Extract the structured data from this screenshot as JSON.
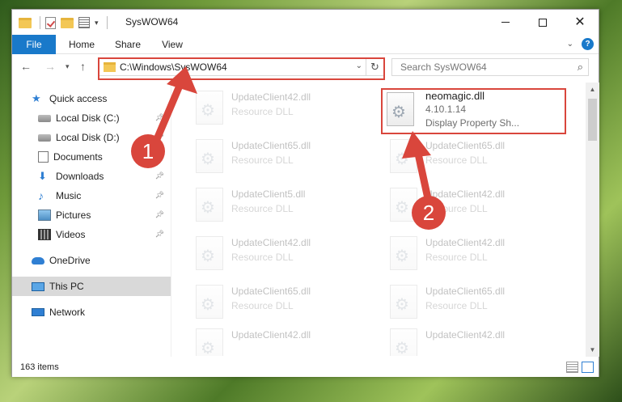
{
  "window": {
    "title": "SysWOW64",
    "controls": {
      "minimize": "—",
      "maximize": "□",
      "close": "✕"
    }
  },
  "ribbon": {
    "tabs": [
      {
        "label": "File"
      },
      {
        "label": "Home"
      },
      {
        "label": "Share"
      },
      {
        "label": "View"
      }
    ],
    "help": "?"
  },
  "navigation": {
    "address": "C:\\Windows\\SysWOW64",
    "search_placeholder": "Search SysWOW64"
  },
  "sidebar": {
    "items": [
      {
        "label": "Quick access",
        "icon": "star-icon"
      },
      {
        "label": "Local Disk (C:)",
        "icon": "disk-icon"
      },
      {
        "label": "Local Disk (D:)",
        "icon": "disk-icon"
      },
      {
        "label": "Documents",
        "icon": "documents-icon"
      },
      {
        "label": "Downloads",
        "icon": "download-icon"
      },
      {
        "label": "Music",
        "icon": "music-icon"
      },
      {
        "label": "Pictures",
        "icon": "pictures-icon"
      },
      {
        "label": "Videos",
        "icon": "videos-icon"
      },
      {
        "label": "OneDrive",
        "icon": "cloud-icon"
      },
      {
        "label": "This PC",
        "icon": "computer-icon"
      },
      {
        "label": "Network",
        "icon": "network-icon"
      }
    ]
  },
  "files": {
    "highlighted": {
      "name": "neomagic.dll",
      "version": "4.10.1.14",
      "description": "Display Property Sh..."
    },
    "items": [
      {
        "name": "UpdateClient42.dll",
        "type": "Resource DLL"
      },
      {
        "name": "UpdateClient65.dll",
        "type": "Resource DLL"
      },
      {
        "name": "UpdateClient65.dll",
        "type": "Resource DLL"
      },
      {
        "name": "UpdateClient5.dll",
        "type": "Resource DLL"
      },
      {
        "name": "UpdateClient42.dll",
        "type": "Resource DLL"
      },
      {
        "name": "UpdateClient42.dll",
        "type": "Resource DLL"
      },
      {
        "name": "UpdateClient42.dll",
        "type": "Resource DLL"
      },
      {
        "name": "UpdateClient65.dll",
        "type": "Resource DLL"
      },
      {
        "name": "UpdateClient65.dll",
        "type": "Resource DLL"
      },
      {
        "name": "UpdateClient42.dll",
        "type": "Resource DLL"
      }
    ]
  },
  "status": {
    "count": "163 items"
  },
  "callouts": {
    "first": "1",
    "second": "2"
  },
  "colors": {
    "accent": "#1979ca",
    "callout": "#d9463c"
  }
}
